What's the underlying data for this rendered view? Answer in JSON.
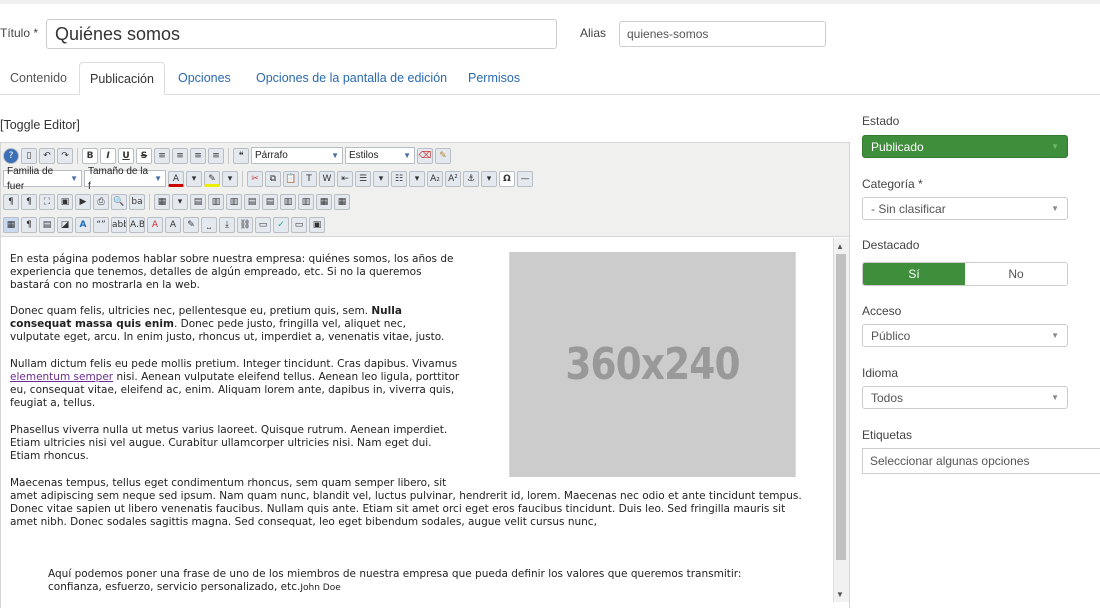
{
  "form": {
    "title_label": "Título *",
    "title_value": "Quiénes somos",
    "alias_label": "Alias",
    "alias_value": "quienes-somos"
  },
  "tabs": [
    {
      "label": "Contenido"
    },
    {
      "label": "Publicación"
    },
    {
      "label": "Opciones"
    },
    {
      "label": "Opciones de la pantalla de edición"
    },
    {
      "label": "Permisos"
    }
  ],
  "editor": {
    "toggle_label": "[Toggle Editor]",
    "toolbar": {
      "format_select": "Párrafo",
      "styles_select": "Estilos",
      "font_family": "Familia de fuer",
      "font_size": "Tamaño de la f"
    },
    "placeholder_image": "360x240",
    "paragraphs": {
      "p1": [
        "En esta página podemos hablar sobre nuestra empresa: quiénes somos, los años de",
        "experiencia que tenemos, detalles de algún empreado, etc. Si no la queremos",
        "bastará con no mostrarla en la web."
      ],
      "p2_pre": "Donec quam felis, ultricies nec, pellentesque eu, pretium quis, sem. ",
      "p2_bold1": "Nulla",
      "p2_bold2": "consequat massa quis enim",
      "p2_post": ". Donec pede justo, fringilla vel, aliquet nec,",
      "p2_line3": "vulputate eget, arcu. In enim justo, rhoncus ut, imperdiet a, venenatis vitae, justo.",
      "p3_line1": "Nullam dictum felis eu pede mollis pretium. Integer tincidunt. Cras dapibus. Vivamus",
      "p3_link": "elementum semper",
      "p3_line2_rest": " nisi. Aenean vulputate eleifend tellus. Aenean leo ligula, porttitor",
      "p3_line3": "eu, consequat vitae, eleifend ac, enim. Aliquam lorem ante, dapibus in, viverra quis,",
      "p3_line4": "feugiat a, tellus.",
      "p4": [
        "Phasellus viverra nulla ut metus varius laoreet. Quisque rutrum. Aenean imperdiet.",
        "Etiam ultricies nisi vel augue. Curabitur ullamcorper ultricies nisi. Nam eget dui.",
        "Etiam rhoncus."
      ],
      "p5": [
        "Maecenas tempus, tellus eget condimentum rhoncus, sem quam semper libero, sit",
        "amet adipiscing sem neque sed ipsum. Nam quam nunc, blandit vel, luctus pulvinar, hendrerit id, lorem. Maecenas nec odio et ante tincidunt tempus.",
        "Donec vitae sapien ut libero venenatis faucibus. Nullam quis ante. Etiam sit amet orci eget eros faucibus tincidunt. Duis leo. Sed fringilla mauris sit",
        "amet nibh. Donec sodales sagittis magna. Sed consequat, leo eget bibendum sodales, augue velit cursus nunc,"
      ],
      "quote_line1": "Aquí podemos poner una frase de uno de los miembros de nuestra empresa que pueda definir los valores que queremos transmitir:",
      "quote_line2": "confianza, esfuerzo, servicio personalizado, etc.",
      "quote_author": "John Doe"
    }
  },
  "sidebar": {
    "estado_label": "Estado",
    "estado_value": "Publicado",
    "categoria_label": "Categoría *",
    "categoria_value": "- Sin clasificar",
    "destacado_label": "Destacado",
    "destacado_yes": "Sí",
    "destacado_no": "No",
    "acceso_label": "Acceso",
    "acceso_value": "Público",
    "idioma_label": "Idioma",
    "idioma_value": "Todos",
    "etiquetas_label": "Etiquetas",
    "etiquetas_placeholder": "Seleccionar algunas opciones"
  },
  "colors": {
    "accent_green": "#3f8e3b",
    "link_blue": "#2a6ab0"
  }
}
